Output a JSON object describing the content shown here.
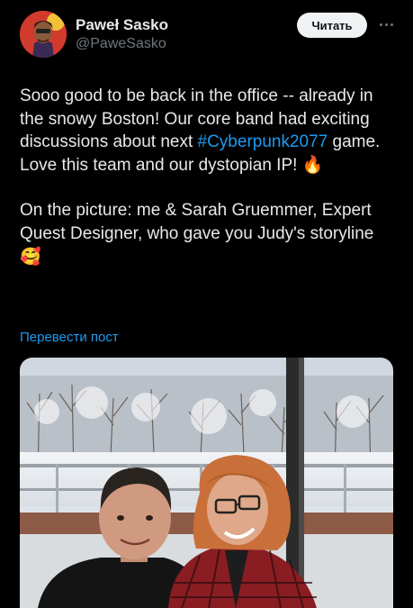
{
  "author": {
    "name": "Paweł Sasko",
    "handle": "@PaweSasko"
  },
  "actions": {
    "follow_label": "Читать",
    "more_icon": "more-dots-icon"
  },
  "tweet": {
    "p1_a": "Sooo good to be back in the office -- already in the snowy Boston! Our core band had exciting discussions about next ",
    "hashtag": "#Cyberpunk2077",
    "p1_b": " game. Love this team and our dystopian IP! ",
    "p1_emoji": "🔥",
    "p2": "On the picture: me & Sarah Gruemmer, Expert Quest Designer, who gave you Judy's storyline",
    "p2_emoji": "🥰"
  },
  "translate_label": "Перевести пост",
  "colors": {
    "background": "#000000",
    "text": "#e7e9ea",
    "secondary": "#71767b",
    "link": "#1d9bf0"
  }
}
